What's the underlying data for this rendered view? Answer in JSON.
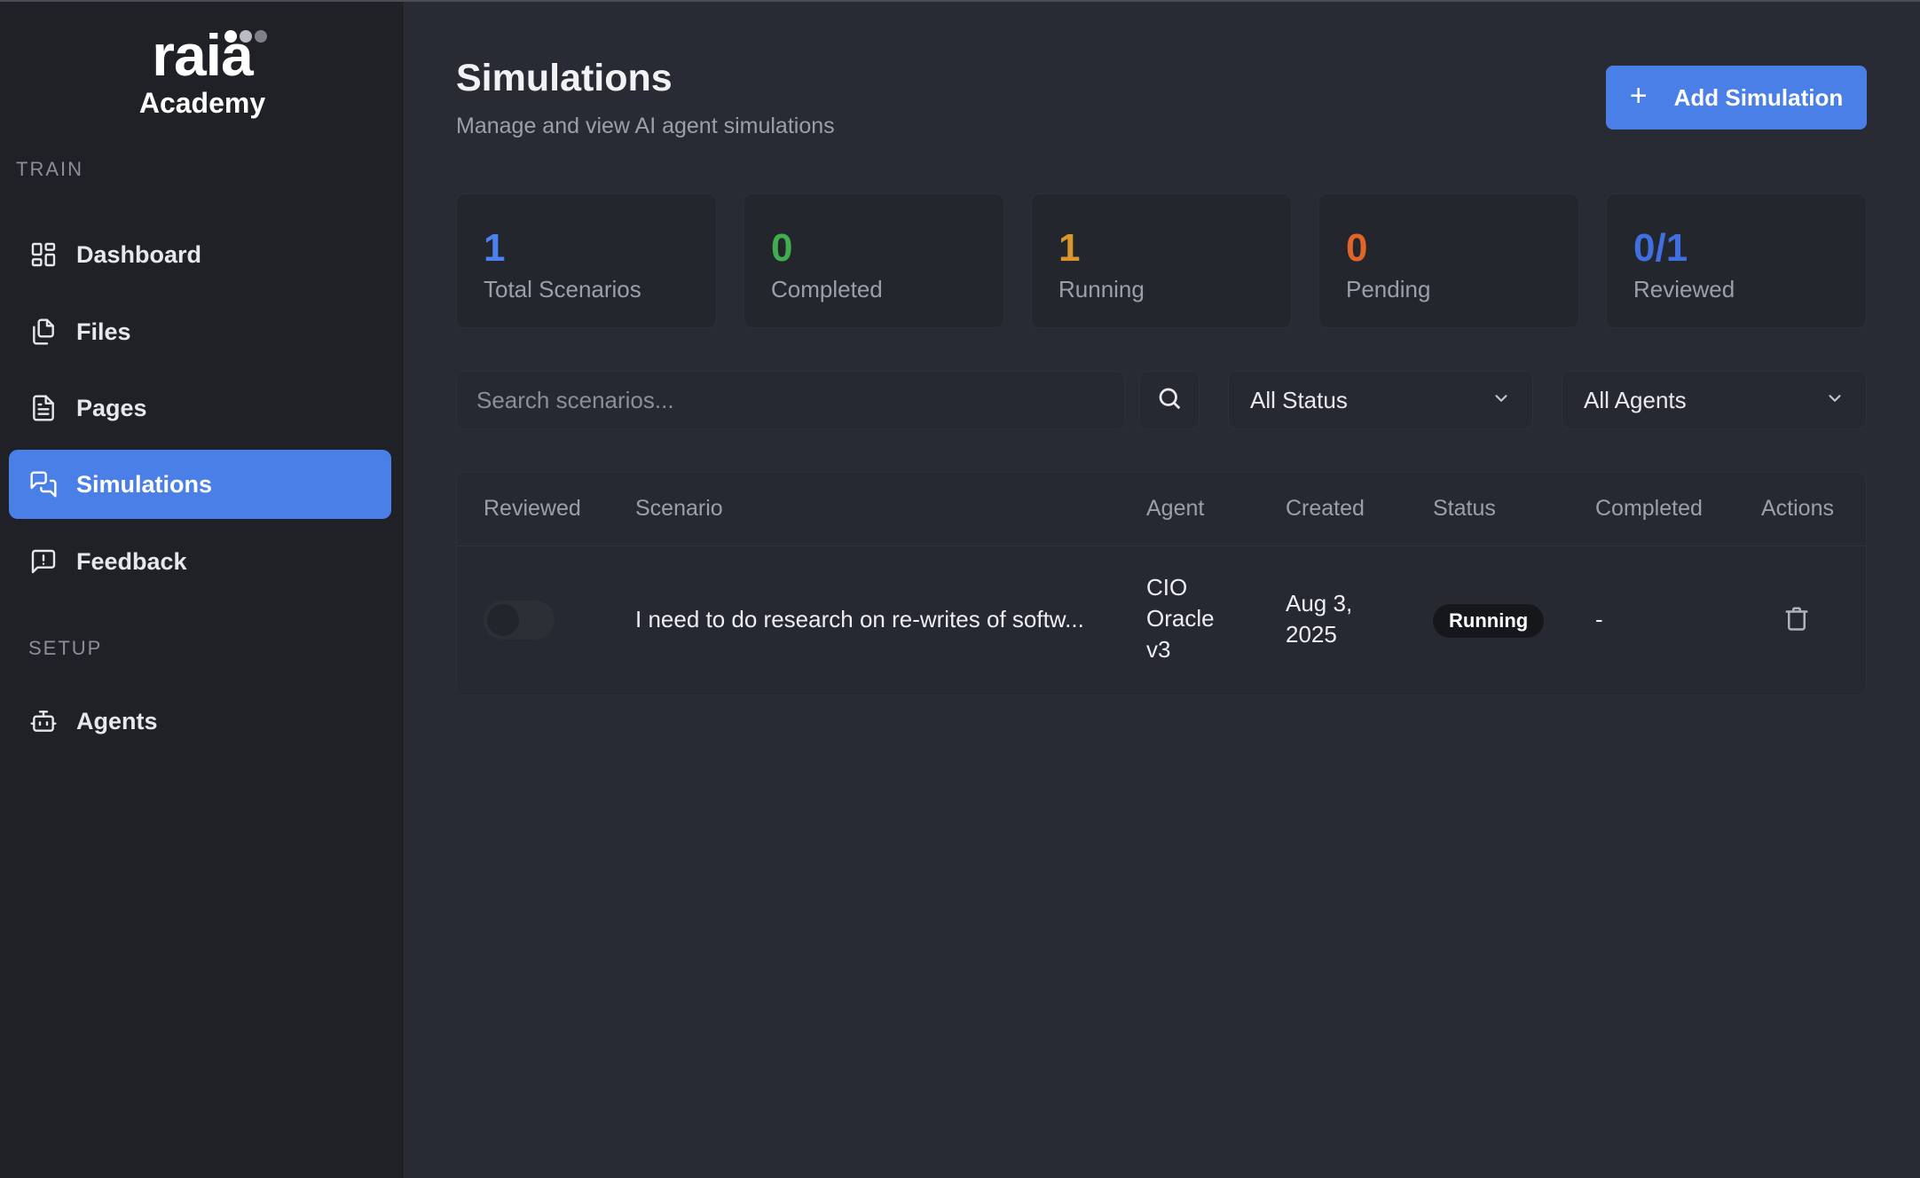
{
  "brand": {
    "logo": "raia",
    "subtitle": "Academy"
  },
  "sidebar": {
    "sections": [
      {
        "label": "TRAIN",
        "items": [
          {
            "label": "Dashboard",
            "icon": "dashboard-grid-icon",
            "active": false
          },
          {
            "label": "Files",
            "icon": "files-icon",
            "active": false
          },
          {
            "label": "Pages",
            "icon": "document-icon",
            "active": false
          },
          {
            "label": "Simulations",
            "icon": "chat-bubbles-icon",
            "active": true
          },
          {
            "label": "Feedback",
            "icon": "feedback-icon",
            "active": false
          }
        ]
      },
      {
        "label": "SETUP",
        "items": [
          {
            "label": "Agents",
            "icon": "robot-icon",
            "active": false
          }
        ]
      }
    ]
  },
  "header": {
    "title": "Simulations",
    "subtitle": "Manage and view AI agent simulations",
    "add_button_icon": "+",
    "add_button_label": "Add Simulation"
  },
  "stats": [
    {
      "value": "1",
      "label": "Total Scenarios",
      "color": "#4a82f0"
    },
    {
      "value": "0",
      "label": "Completed",
      "color": "#3fae4f"
    },
    {
      "value": "1",
      "label": "Running",
      "color": "#d9962c"
    },
    {
      "value": "0",
      "label": "Pending",
      "color": "#e2642a"
    },
    {
      "value": "0/1",
      "label": "Reviewed",
      "color": "#3f6fe0"
    }
  ],
  "filters": {
    "search_placeholder": "Search scenarios...",
    "search_value": "",
    "status_selected": "All Status",
    "agent_selected": "All Agents"
  },
  "table": {
    "columns": [
      "Reviewed",
      "Scenario",
      "Agent",
      "Created",
      "Status",
      "Completed",
      "Actions"
    ],
    "rows": [
      {
        "reviewed": false,
        "scenario": "I need to do research on re-writes of softw...",
        "agent_lines": [
          "CIO",
          "Oracle",
          "v3"
        ],
        "created_lines": [
          "Aug 3,",
          "2025"
        ],
        "status": "Running",
        "completed": "-",
        "action_icon": "trash-icon"
      }
    ]
  },
  "colors": {
    "accent": "#4a7fe8",
    "sidebar_bg": "#1f2127",
    "main_bg": "#282b33"
  }
}
